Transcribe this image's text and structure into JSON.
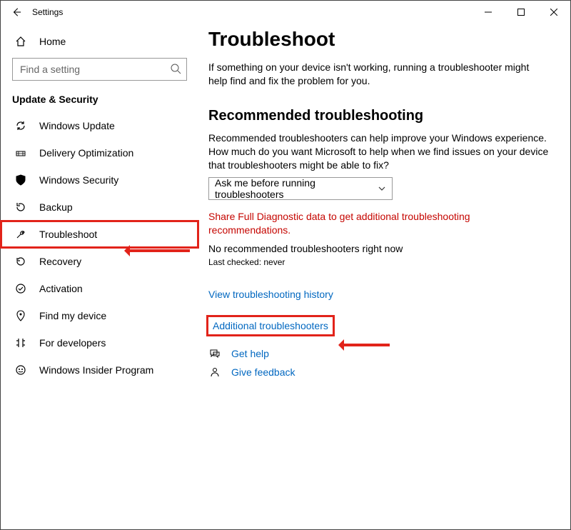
{
  "window": {
    "title": "Settings"
  },
  "sidebar": {
    "home": "Home",
    "search_placeholder": "Find a setting",
    "category": "Update & Security",
    "items": [
      {
        "label": "Windows Update"
      },
      {
        "label": "Delivery Optimization"
      },
      {
        "label": "Windows Security"
      },
      {
        "label": "Backup"
      },
      {
        "label": "Troubleshoot",
        "selected": true
      },
      {
        "label": "Recovery"
      },
      {
        "label": "Activation"
      },
      {
        "label": "Find my device"
      },
      {
        "label": "For developers"
      },
      {
        "label": "Windows Insider Program"
      }
    ]
  },
  "main": {
    "title": "Troubleshoot",
    "intro": "If something on your device isn't working, running a troubleshooter might help find and fix the problem for you.",
    "rec_title": "Recommended troubleshooting",
    "rec_desc": "Recommended troubleshooters can help improve your Windows experience. How much do you want Microsoft to help when we find issues on your device that troubleshooters might be able to fix?",
    "combo_value": "Ask me before running troubleshooters",
    "warn": "Share Full Diagnostic data to get additional troubleshooting recommendations.",
    "none": "No recommended troubleshooters right now",
    "last_checked": "Last checked: never",
    "history_link": "View troubleshooting history",
    "additional_link": "Additional troubleshooters",
    "get_help": "Get help",
    "give_feedback": "Give feedback"
  }
}
